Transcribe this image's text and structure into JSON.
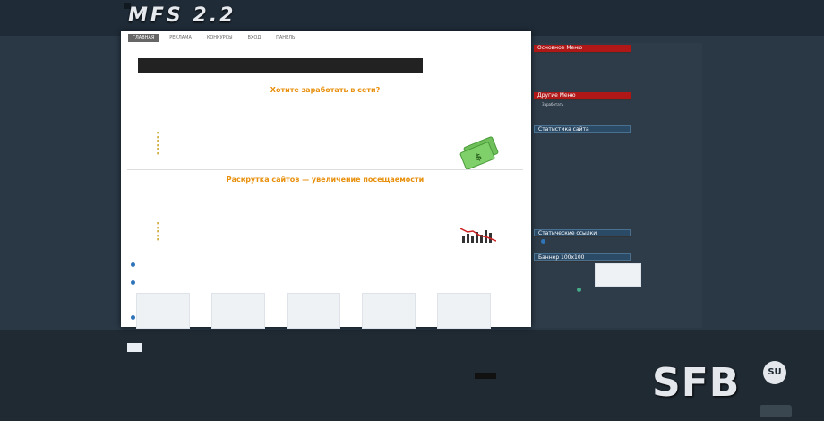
{
  "header": {
    "date": "",
    "logo": "MFS 2.2",
    "tagline_line1": "",
    "tagline_line2": ""
  },
  "nav": {
    "tabs": [
      "ГЛАВНАЯ",
      "РЕКЛАМА",
      "КОНКУРСЫ",
      "ВХОД",
      "ПАНЕЛЬ"
    ]
  },
  "search": {
    "placeholder": ""
  },
  "main": {
    "page_title": "",
    "add_page": "",
    "banner_text": "",
    "banner_rotator_left": "",
    "banner_rotator_right": "",
    "intro": "",
    "heading1": "Хотите заработать в сети?",
    "offer1": "",
    "list1": [
      "",
      "",
      "",
      "",
      "",
      ""
    ],
    "register": "",
    "heading2": "Раскрутка сайтов — увеличение посещаемости",
    "intro2": "",
    "offer2": "",
    "list2": [
      "",
      "",
      "",
      "",
      ""
    ],
    "order_ad": "",
    "paid_ads_title": "",
    "paid_info_left": "",
    "paid_info_right": "",
    "text_ads_title": "",
    "text_ads_sub": "",
    "text_ads_left": "",
    "text_ads_right": "",
    "rotator_title": "",
    "rotator_slots": [
      "",
      "",
      "",
      "",
      ""
    ],
    "rotator_bottom_left": "",
    "rotator_bottom_right": ""
  },
  "sidebar": {
    "menu_title": "Основное Меню",
    "menu_items": [
      "",
      "",
      "",
      ""
    ],
    "other_title": "Другие Меню",
    "other_items": [
      "Заработать",
      ""
    ],
    "stats_title": "Статистика сайта",
    "stats": [
      {
        "label": "",
        "value": ""
      },
      {
        "label": "",
        "value": ""
      },
      {
        "label": "",
        "value": ""
      },
      {
        "label": "",
        "value": ""
      },
      {
        "label": "",
        "value": ""
      },
      {
        "label": "",
        "value": ""
      },
      {
        "label": "",
        "value": ""
      },
      {
        "label": "",
        "value": ""
      },
      {
        "label": "",
        "value": ""
      },
      {
        "label": "",
        "value": ""
      },
      {
        "label": "",
        "value": ""
      },
      {
        "label": "",
        "value": ""
      },
      {
        "label": "",
        "value": ""
      },
      {
        "label": "",
        "value": ""
      },
      {
        "label": "",
        "value": ""
      },
      {
        "label": "",
        "value": ""
      },
      {
        "label": "",
        "value": ""
      }
    ],
    "admins": "",
    "footer_left": "",
    "footer_right": "",
    "static_title": "Статические ссылки",
    "static_left": "",
    "static_right": "",
    "banner_title": "Баннер 100x100",
    "banner_slot": "",
    "banner_left": "",
    "banner_right": ""
  },
  "footer": {
    "col1": [
      "",
      "",
      "",
      ""
    ],
    "col1_links": [
      "",
      ""
    ],
    "col2": [
      "",
      "",
      "",
      ""
    ],
    "col2_link": "",
    "counter": "",
    "col3_left": "",
    "col3_right": "",
    "col4_left": "",
    "col4_right": "",
    "bottom1": "",
    "bottom2": "",
    "brand": "SFB",
    "brand_su": "SU"
  },
  "colors": {
    "accent_orange": "#e8900d",
    "link_blue": "#2f74b8",
    "link_green": "#44aa88",
    "menu_red": "#b01717"
  }
}
